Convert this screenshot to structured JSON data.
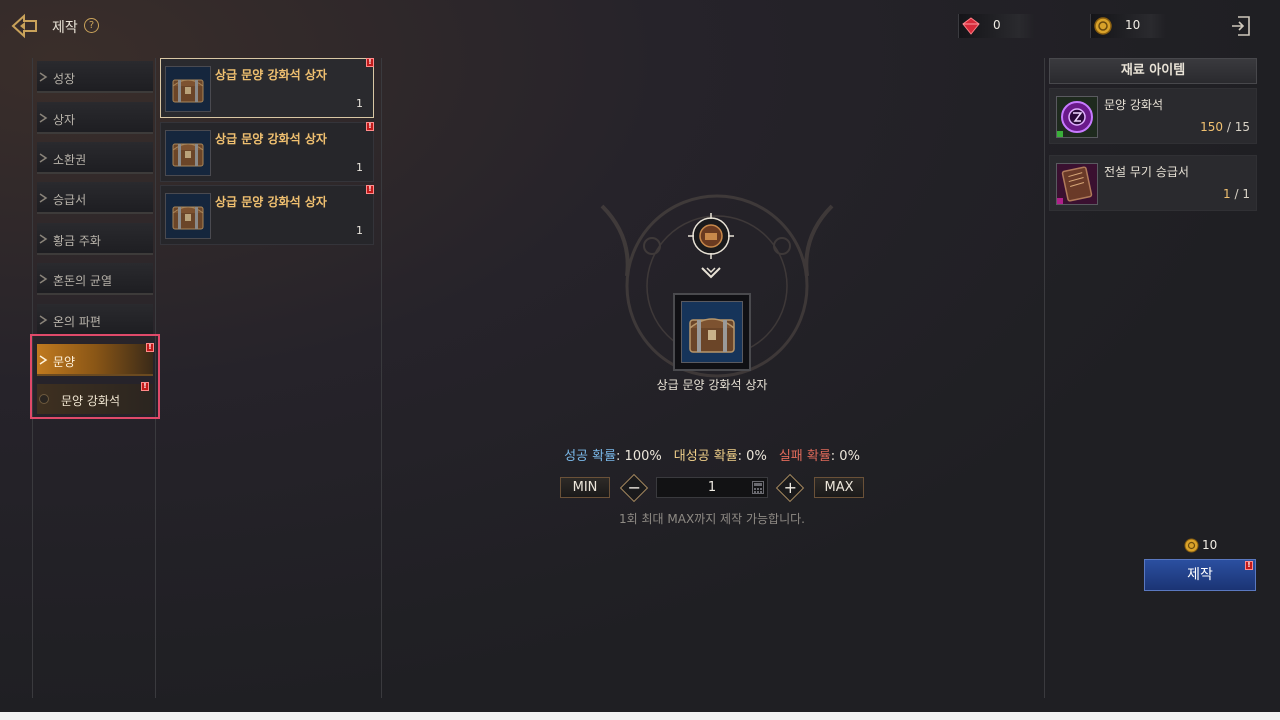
{
  "header": {
    "title": "제작",
    "help_glyph": "?",
    "back_icon": "back-arrow-icon",
    "exit_icon": "exit-door-icon"
  },
  "currencies": [
    {
      "icon": "red-gem-icon",
      "value": "0",
      "color": "#d62a3a"
    },
    {
      "icon": "gold-coin-icon",
      "value": "10",
      "color": "#d9a22a"
    }
  ],
  "sidebar": {
    "items": [
      {
        "label": "성장"
      },
      {
        "label": "상자"
      },
      {
        "label": "소환권"
      },
      {
        "label": "승급서"
      },
      {
        "label": "황금 주화"
      },
      {
        "label": "혼돈의 균열"
      },
      {
        "label": "온의 파편"
      },
      {
        "label": "문양",
        "active": true,
        "alert": true
      }
    ],
    "sub_item": {
      "label": "문양 강화석",
      "alert": true
    },
    "alert_glyph": "!"
  },
  "recipes": [
    {
      "name": "상급 문양 강화석 상자",
      "count": "1",
      "selected": true,
      "alert": true
    },
    {
      "name": "상급 문양 강화석 상자",
      "count": "1",
      "selected": false,
      "alert": true
    },
    {
      "name": "상급 문양 강화석 상자",
      "count": "1",
      "selected": false,
      "alert": true
    }
  ],
  "result": {
    "name": "상급 문양 강화석 상자",
    "icon": "treasure-chest-icon"
  },
  "rates": {
    "success_label": "성공 확률",
    "success_value": ": 100%",
    "great_label": "대성공 확률",
    "great_value": ": 0%",
    "fail_label": "실패 확률",
    "fail_value": ": 0%"
  },
  "quantity": {
    "min_label": "MIN",
    "max_label": "MAX",
    "minus_glyph": "−",
    "plus_glyph": "+",
    "value": "1",
    "note": "1회 최대 MAX까지 제작 가능합니다."
  },
  "materials": {
    "header": "재료 아이템",
    "items": [
      {
        "name": "문양 강화석",
        "have": "150",
        "need": " / 15",
        "icon": "purple-glyph-stone-icon"
      },
      {
        "name": "전설 무기 승급서",
        "have": "1",
        "need": " / 1",
        "icon": "legendary-book-icon"
      }
    ]
  },
  "craft": {
    "cost": "10",
    "button_label": "제작",
    "accent": "#2b4fa0"
  },
  "colors": {
    "accent_gold": "#c07a1f",
    "highlight_border": "#e04a6a",
    "recipe_name": "#f0c070"
  }
}
